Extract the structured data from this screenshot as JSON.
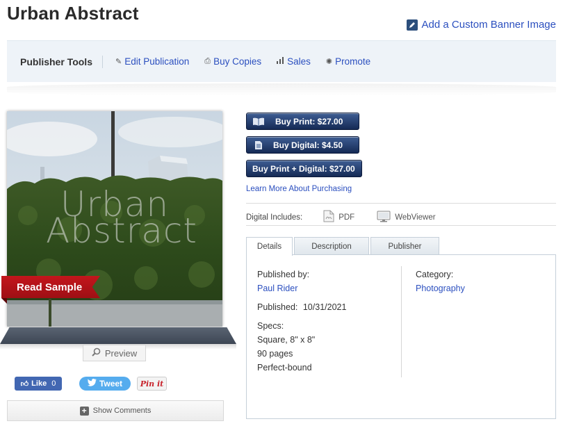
{
  "page": {
    "title": "Urban Abstract"
  },
  "banner_link": {
    "label": "Add a Custom Banner Image",
    "icon": "edit-icon"
  },
  "publisher_tools": {
    "label": "Publisher Tools",
    "items": [
      {
        "label": "Edit Publication",
        "icon": "pencil-icon"
      },
      {
        "label": "Buy Copies",
        "icon": "printer-icon"
      },
      {
        "label": "Sales",
        "icon": "bar-chart-icon"
      },
      {
        "label": "Promote",
        "icon": "asterisk-icon"
      }
    ]
  },
  "cover": {
    "title_line1": "Urban",
    "title_line2": "Abstract",
    "read_sample_label": "Read Sample",
    "preview_label": "Preview"
  },
  "social": {
    "like_label": "Like",
    "like_count": "0",
    "tweet_label": "Tweet",
    "pin_label": "Pin it"
  },
  "comments": {
    "label": "Show Comments"
  },
  "buy": {
    "print": "Buy Print: $27.00",
    "digital": "Buy Digital: $4.50",
    "bundle": "Buy Print + Digital: $27.00",
    "learn_more": "Learn More About Purchasing"
  },
  "digital_includes": {
    "label": "Digital Includes:",
    "pdf": "PDF",
    "webviewer": "WebViewer"
  },
  "tabs": [
    "Details",
    "Description",
    "Publisher"
  ],
  "details": {
    "published_by_label": "Published by:",
    "publisher": "Paul Rider",
    "published_label": "Published:",
    "published_date": "10/31/2021",
    "specs_label": "Specs:",
    "size": "Square, 8\" x 8\"",
    "pages": "90 pages",
    "binding": "Perfect-bound",
    "category_label": "Category:",
    "category": "Photography"
  },
  "colors": {
    "link": "#2b4fbf",
    "buy_button": "#1f3a6e",
    "read_sample": "#b3131a",
    "toolbar_bg": "#eef3f8"
  }
}
